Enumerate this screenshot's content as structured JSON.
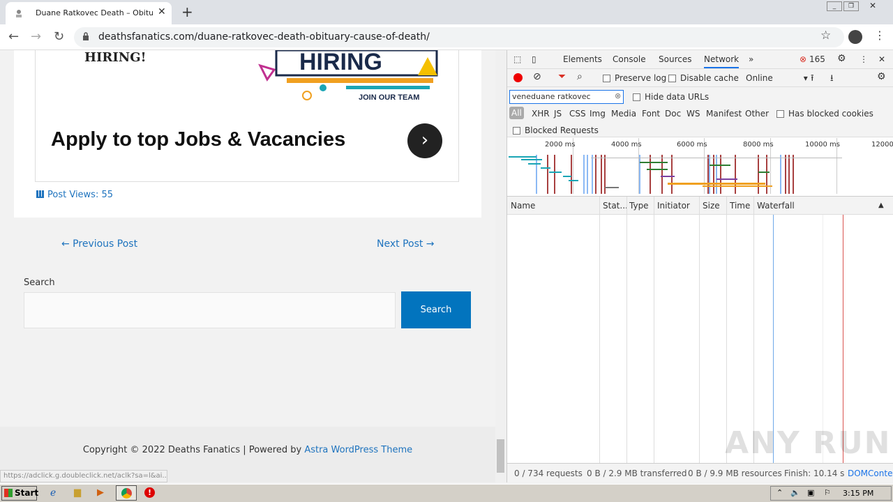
{
  "browser": {
    "tab_title": "Duane Ratkovec Death – Obituary, C",
    "tab_close": "✕",
    "new_tab": "+",
    "url": "deathsfanatics.com/duane-ratkovec-death-obituary-cause-of-death/"
  },
  "page": {
    "hiring_image_top_text": "HIRING!",
    "hiring_banner_text": "HIRING",
    "join_team": "JOIN OUR TEAM",
    "apply_text": "Apply to top Jobs & Vacancies",
    "post_views": "Post Views: 55",
    "prev_post": "← Previous Post",
    "next_post": "Next Post →",
    "search_label": "Search",
    "search_button": "Search",
    "copyright_prefix": "Copyright © 2022 Deaths Fanatics | Powered by ",
    "copyright_link": "Astra WordPress Theme",
    "status_url": "https://adclick.g.doubleclick.net/aclk?sa=l&ai..."
  },
  "devtools": {
    "tabs": [
      "Elements",
      "Console",
      "Sources",
      "Network"
    ],
    "more": "»",
    "error_count": "165",
    "preserve_log": "Preserve log",
    "disable_cache": "Disable cache",
    "throttle": "Online",
    "filter_value": "veneduane ratkovec",
    "hide_data_urls": "Hide data URLs",
    "types": [
      "All",
      "XHR",
      "JS",
      "CSS",
      "Img",
      "Media",
      "Font",
      "Doc",
      "WS",
      "Manifest",
      "Other"
    ],
    "has_blocked_cookies": "Has blocked cookies",
    "blocked_requests": "Blocked Requests",
    "overview_ticks": [
      "2000 ms",
      "4000 ms",
      "6000 ms",
      "8000 ms",
      "10000 ms",
      "12000"
    ],
    "columns": [
      "Name",
      "Stat...",
      "Type",
      "Initiator",
      "Size",
      "Time",
      "Waterfall"
    ],
    "summary": {
      "requests": "0 / 734 requests",
      "transferred": "0 B / 2.9 MB transferred",
      "resources": "0 B / 9.9 MB resources",
      "finish": "Finish: 10.14 s",
      "domcontent": "DOMConter"
    }
  },
  "taskbar": {
    "start": "Start",
    "clock": "3:15 PM"
  },
  "watermark": "ANY RUN"
}
